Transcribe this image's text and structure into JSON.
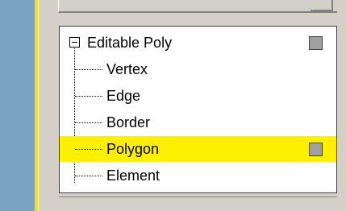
{
  "modifier_stack": {
    "root": {
      "label": "Editable Poly",
      "expanded": true,
      "expand_icon": "minus-box-icon",
      "toggle_icon": "gray-square-icon"
    },
    "subobjects": [
      {
        "label": "Vertex",
        "selected": false
      },
      {
        "label": "Edge",
        "selected": false
      },
      {
        "label": "Border",
        "selected": false
      },
      {
        "label": "Polygon",
        "selected": true,
        "toggle_icon": "gray-square-icon"
      },
      {
        "label": "Element",
        "selected": false
      }
    ]
  },
  "colors": {
    "highlight": "#fff000",
    "side_strip": "#7aa3c1",
    "accent_bar": "#f3e21a",
    "panel": "#d4d0c8"
  }
}
